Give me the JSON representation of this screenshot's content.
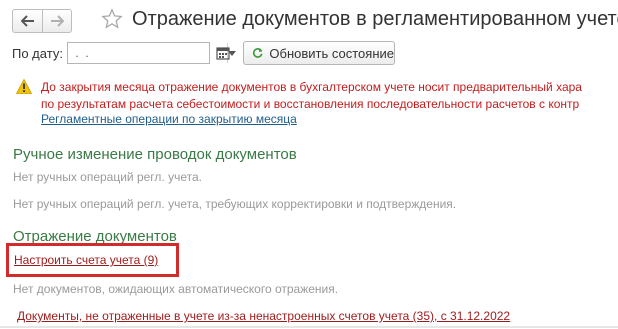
{
  "header": {
    "title": "Отражение документов в регламентированном учете",
    "back_icon": "arrow-left-icon",
    "forward_icon": "arrow-right-icon",
    "favorite_icon": "star-icon"
  },
  "filter": {
    "date_label": "По дату:",
    "date_value": " .  .    ",
    "refresh_label": "Обновить состояние"
  },
  "warning": {
    "line1": "До закрытия месяца отражение документов в бухгалтерском учете носит предварительный хара",
    "line2": "по результатам расчета себестоимости и восстановления последовательности расчетов с контр",
    "link": "Регламентные операции по закрытию месяца",
    "color": "#c21d1d"
  },
  "manual": {
    "title": "Ручное изменение проводок документов",
    "info1": "Нет ручных операций регл. учета.",
    "info2": "Нет ручных операций регл. учета, требующих корректировки и подтверждения."
  },
  "reflection": {
    "title": "Отражение документов",
    "setup_link": "Настроить счета учета (9)",
    "info": "Нет документов, ожидающих автоматического отражения.",
    "unreflected_link": "Документы, не отраженные в учете из-за ненастроенных счетов учета (35), с 31.12.2022"
  },
  "colors": {
    "section_title": "#3a7a46",
    "link_blue": "#1f5e8a",
    "link_red": "#9e1b1b",
    "highlight": "#d12b2b"
  }
}
